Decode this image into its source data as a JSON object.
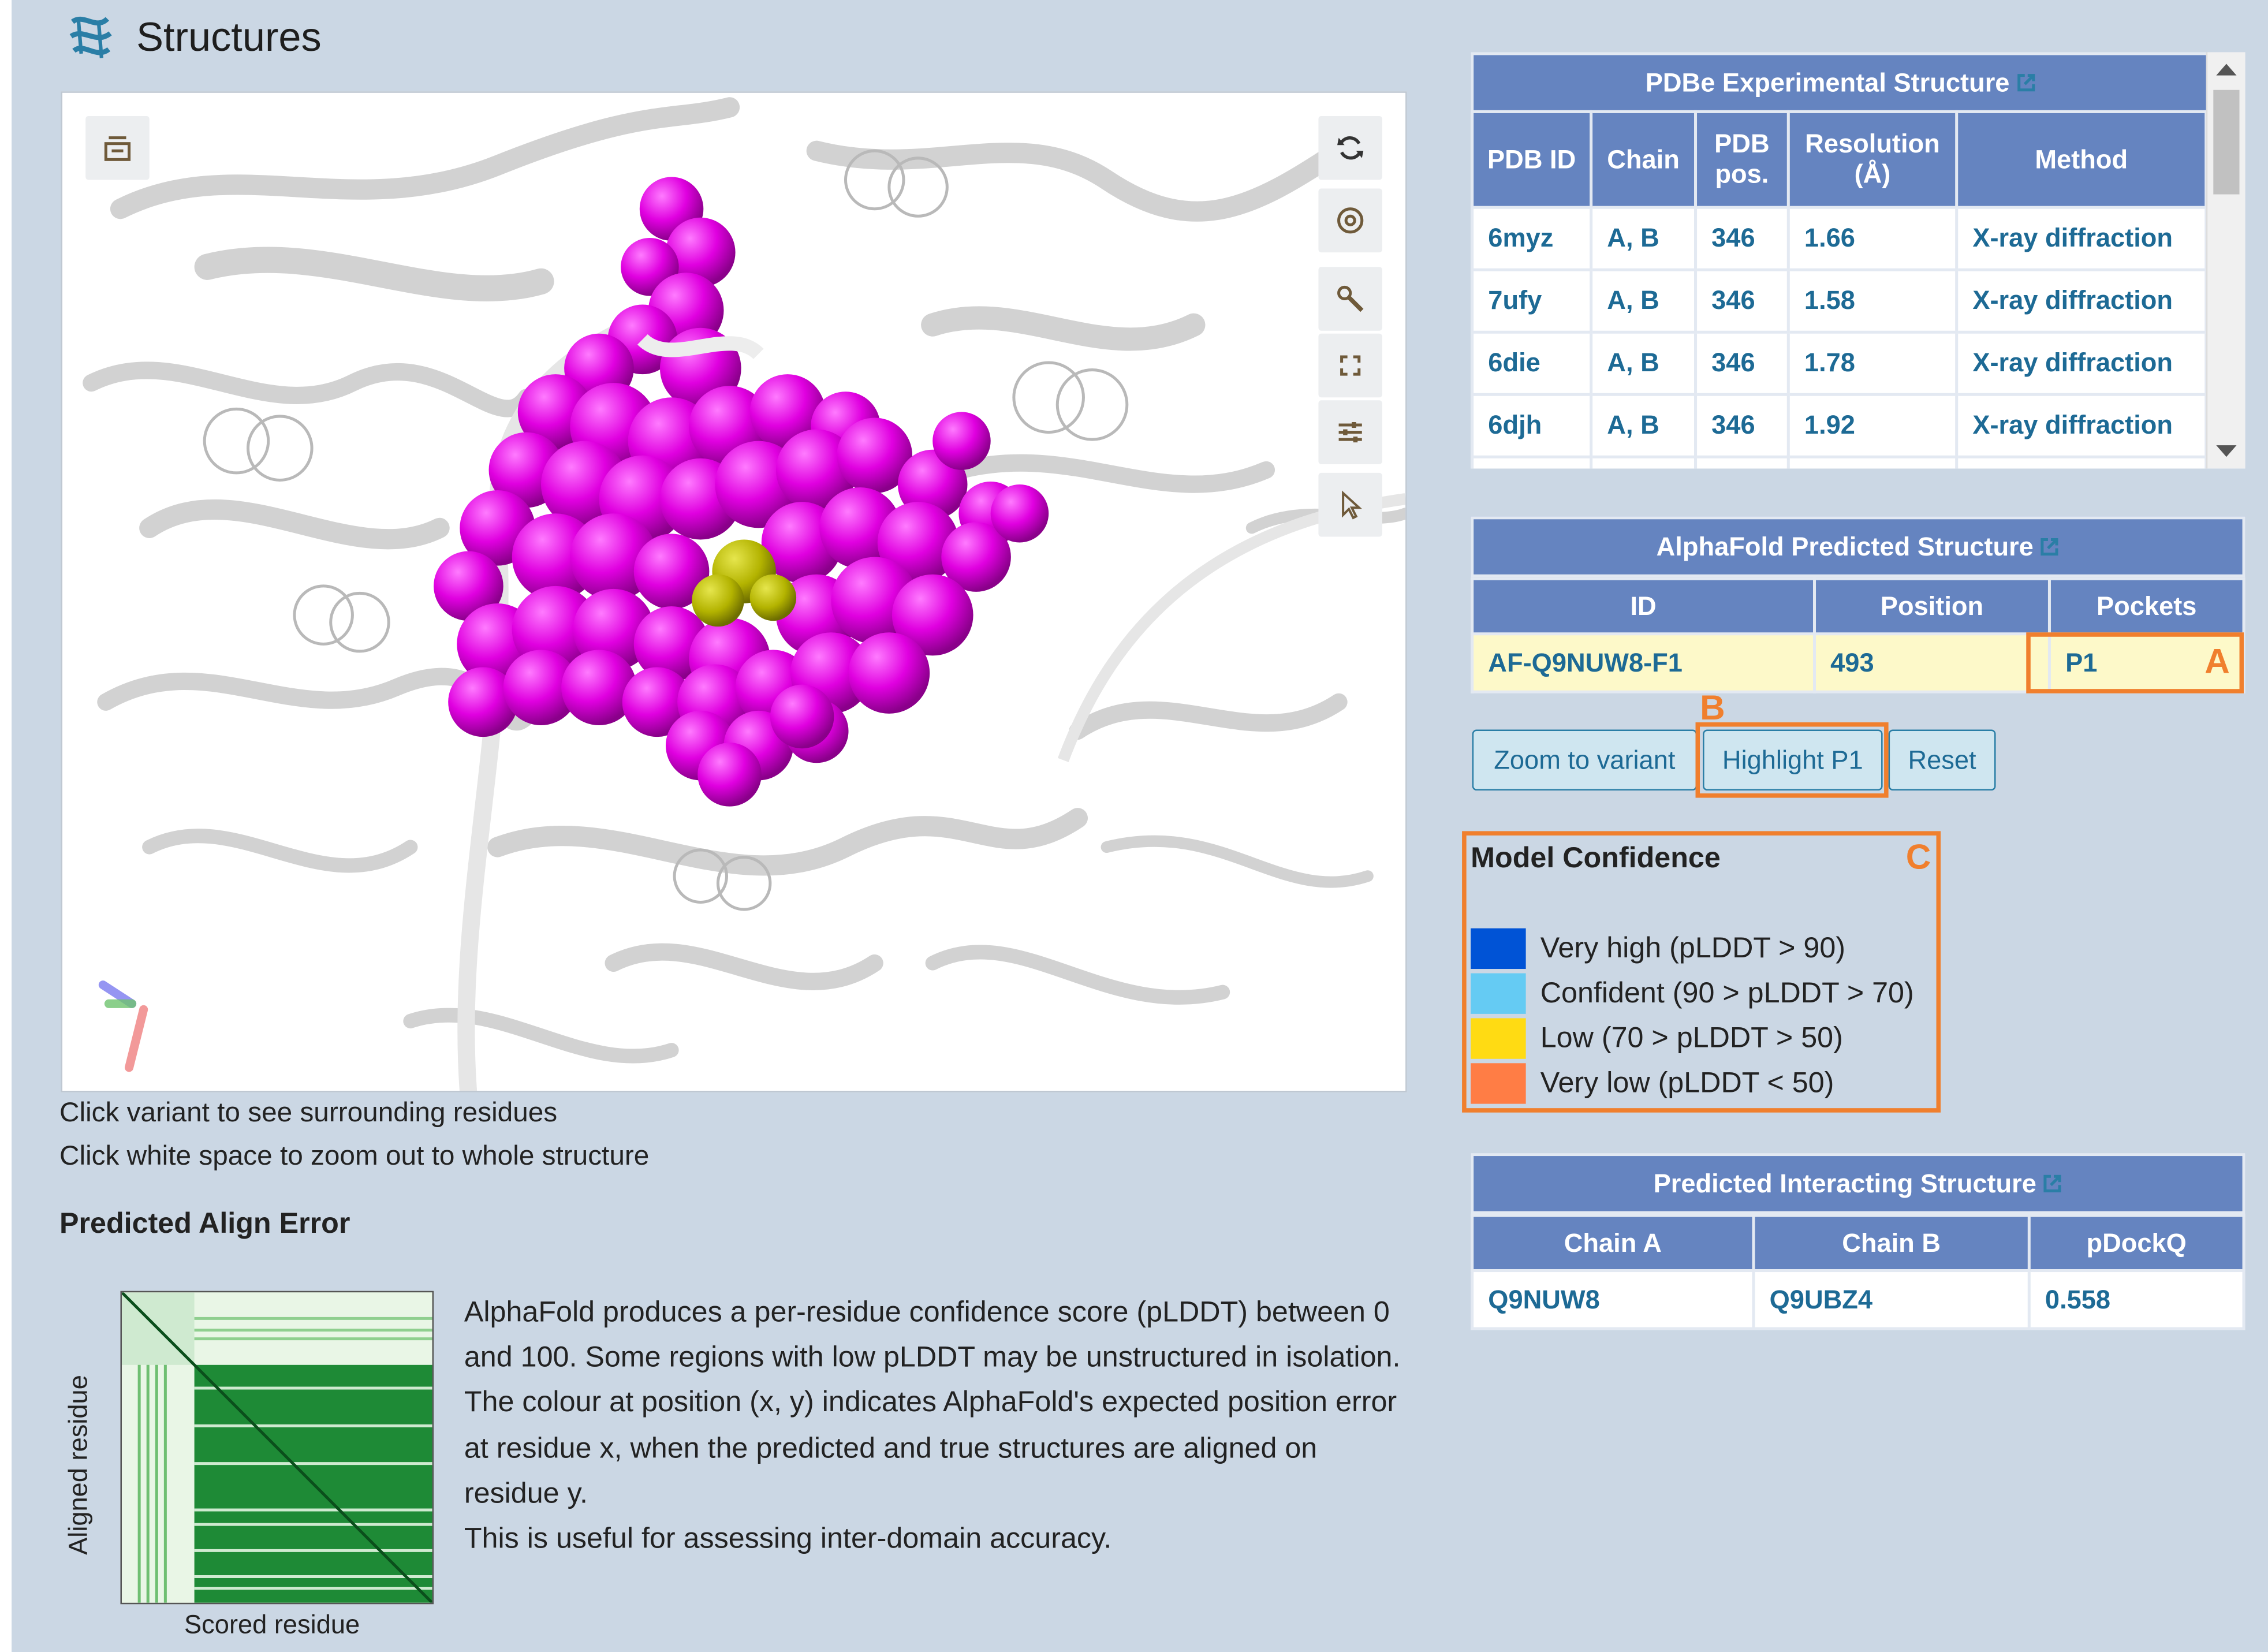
{
  "section": {
    "title": "Structures"
  },
  "viewer": {
    "hint_1": "Click variant to see surrounding residues",
    "hint_2": "Click white space to zoom out to whole structure"
  },
  "pae": {
    "heading": "Predicted Align Error",
    "ylabel": "Aligned residue",
    "xlabel": "Scored residue",
    "paragraphs": [
      "AlphaFold produces a per-residue confidence score (pLDDT) between 0 and 100. Some regions with low pLDDT may be unstructured in isolation.",
      "The colour at position (x, y) indicates AlphaFold's expected position error at residue x, when the predicted and true structures are aligned on residue y.",
      "This is useful for assessing inter-domain accuracy."
    ]
  },
  "pdbe": {
    "title": "PDBe Experimental Structure",
    "headers": [
      "PDB ID",
      "Chain",
      "PDB pos.",
      "Resolution (Å)",
      "Method"
    ],
    "rows": [
      [
        "6myz",
        "A, B",
        "346",
        "1.66",
        "X-ray diffraction"
      ],
      [
        "7ufy",
        "A, B",
        "346",
        "1.58",
        "X-ray diffraction"
      ],
      [
        "6die",
        "A, B",
        "346",
        "1.78",
        "X-ray diffraction"
      ],
      [
        "6djh",
        "A, B",
        "346",
        "1.92",
        "X-ray diffraction"
      ]
    ]
  },
  "alphafold": {
    "title": "AlphaFold Predicted Structure",
    "headers": [
      "ID",
      "Position",
      "Pockets"
    ],
    "row": [
      "AF-Q9NUW8-F1",
      "493",
      "P1"
    ]
  },
  "buttons": {
    "zoom": "Zoom to variant",
    "highlight": "Highlight P1",
    "reset": "Reset"
  },
  "annotations": {
    "a": "A",
    "b": "B",
    "c": "C"
  },
  "confidence": {
    "title": "Model Confidence",
    "items": [
      {
        "label": "Very high (pLDDT > 90)",
        "color": "#0053d6"
      },
      {
        "label": "Confident (90 > pLDDT > 70)",
        "color": "#65cbf3"
      },
      {
        "label": "Low (70 > pLDDT > 50)",
        "color": "#ffdb13"
      },
      {
        "label": "Very low (pLDDT < 50)",
        "color": "#ff7d45"
      }
    ]
  },
  "interacting": {
    "title": "Predicted Interacting Structure",
    "headers": [
      "Chain A",
      "Chain B",
      "pDockQ"
    ],
    "row": [
      "Q9NUW8",
      "Q9UBZ4",
      "0.558"
    ]
  },
  "colors": {
    "page_bg": "#cbd7e4",
    "header_blue": "#6584c0",
    "link_text": "#1d6a95",
    "annotation_orange": "#f07f2d",
    "pocket_magenta": "#e000e0",
    "variant_olive": "#b3b300"
  }
}
